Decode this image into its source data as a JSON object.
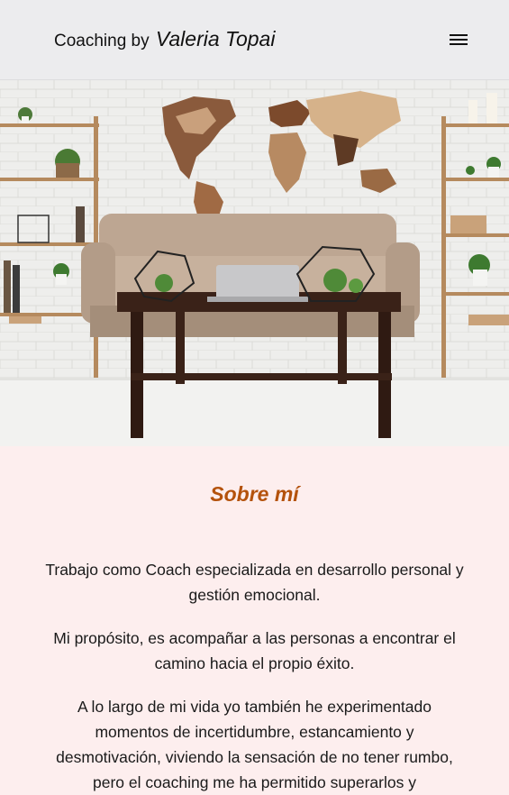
{
  "header": {
    "brand_prefix": "Coaching by",
    "brand_name": "Valeria Topai",
    "menu_icon": "hamburger-menu-icon"
  },
  "hero": {
    "image": "living-room-photo"
  },
  "about": {
    "title": "Sobre mí",
    "paragraphs": [
      "Trabajo como Coach especializada en desarrollo personal y gestión emocional.",
      "Mi propósito, es acompañar a las personas a encontrar el camino hacia el propio éxito.",
      "A lo largo de mi vida yo también he experimentado momentos de incertidumbre, estancamiento y desmotivación, viviendo la sensación de no tener rumbo, pero el coaching me ha permitido superarlos y"
    ]
  },
  "colors": {
    "accent": "#b4520c",
    "header_bg": "#ececee",
    "content_bg": "#fdeeee"
  }
}
